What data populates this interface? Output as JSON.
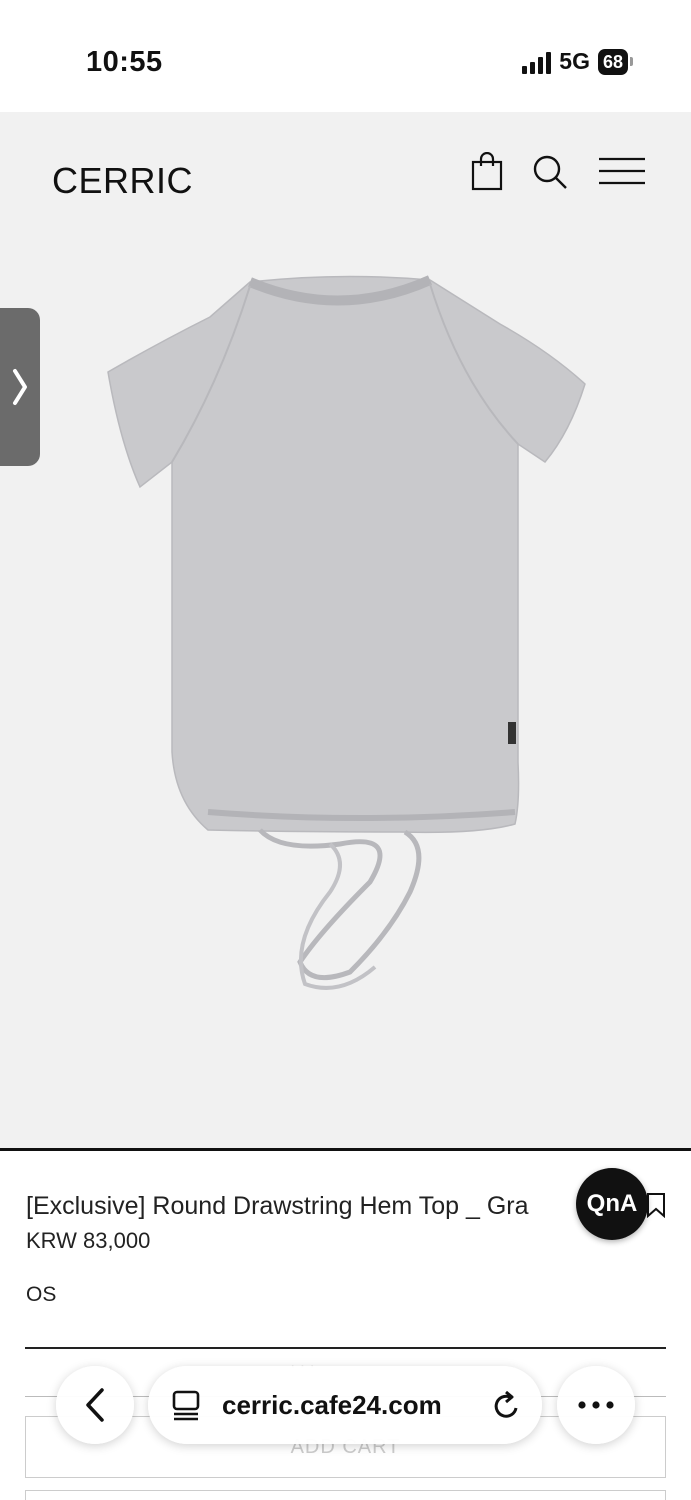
{
  "status_bar": {
    "time": "10:55",
    "network": "5G",
    "battery": "68"
  },
  "header": {
    "brand": "CERRIC"
  },
  "product": {
    "name": "[Exclusive] Round Drawstring Hem Top _ Gra",
    "price": "KRW 83,000",
    "option": "OS",
    "faded_text": "·  ·  ·",
    "add_cart_label": "ADD CART"
  },
  "qna": {
    "label": "QnA"
  },
  "browser": {
    "url": "cerric.cafe24.com"
  },
  "colors": {
    "hero_bg": "#f1f1f1",
    "text": "#111111",
    "tab": "#6b6b6b",
    "shirt": "#c9c9cc"
  },
  "icons": [
    "bag-icon",
    "search-icon",
    "menu-icon",
    "chevron-right-icon",
    "bookmark-icon",
    "back-icon",
    "tabs-icon",
    "reload-icon",
    "more-icon"
  ]
}
